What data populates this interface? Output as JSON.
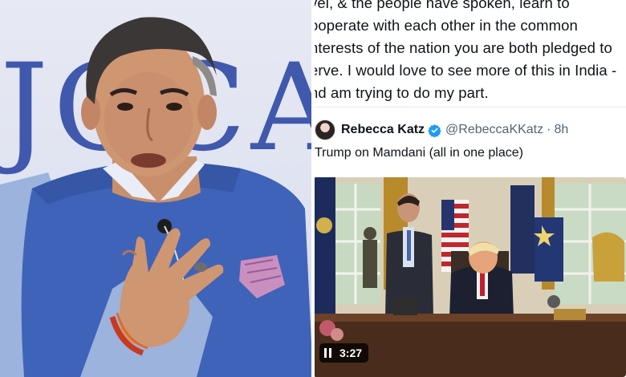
{
  "left_photo": {
    "backdrop_text": "JGCA"
  },
  "quote": {
    "lines": [
      "vel, & the people have spoken, learn to",
      "ooperate with each other in the common",
      "nterests of the nation you are both pledged to",
      "erve. I would love to see more of this in India -",
      "nd am trying to do my part."
    ]
  },
  "tweet": {
    "display_name": "Rebecca Katz",
    "handle": "@RebeccaKKatz",
    "separator": "·",
    "time": "8h",
    "text": "Trump on Mamdani (all in one place)",
    "video": {
      "duration": "3:27"
    }
  },
  "colors": {
    "verified_badge": "#1d9bf0",
    "handle_gray": "#536471",
    "text_dark": "#0f1419"
  },
  "icons": {
    "verified": "verified-badge-icon",
    "pause": "pause-icon"
  }
}
